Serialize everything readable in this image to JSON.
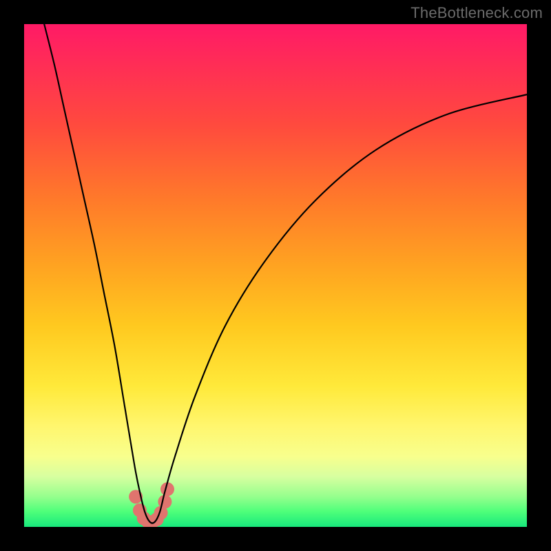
{
  "watermark": "TheBottleneck.com",
  "chart_data": {
    "type": "line",
    "title": "",
    "xlabel": "",
    "ylabel": "",
    "xlim": [
      0,
      100
    ],
    "ylim": [
      0,
      100
    ],
    "grid": false,
    "series": [
      {
        "name": "curve",
        "color": "#000000",
        "x": [
          4,
          6,
          8,
          10,
          12,
          14,
          16,
          18,
          20,
          22,
          23,
          24,
          25,
          26,
          27,
          28,
          30,
          34,
          40,
          48,
          58,
          70,
          84,
          100
        ],
        "y": [
          100,
          92,
          83,
          74,
          65,
          56,
          46,
          36,
          24,
          12,
          7,
          3,
          1,
          1,
          3,
          7,
          14,
          26,
          40,
          53,
          65,
          75,
          82,
          86
        ]
      },
      {
        "name": "trough-markers",
        "color": "#e0746e",
        "type": "scatter",
        "x": [
          22.2,
          23.0,
          23.8,
          24.7,
          25.5,
          26.4,
          27.2,
          28.0,
          28.5
        ],
        "y": [
          6.0,
          3.3,
          1.7,
          1.0,
          1.0,
          1.5,
          2.8,
          5.0,
          7.5
        ]
      }
    ],
    "background_gradient": {
      "top": "#ff1a66",
      "upper_mid": "#ff7a2a",
      "mid": "#ffe93a",
      "lower_mid": "#d7ffa0",
      "bottom": "#18e87c"
    }
  }
}
